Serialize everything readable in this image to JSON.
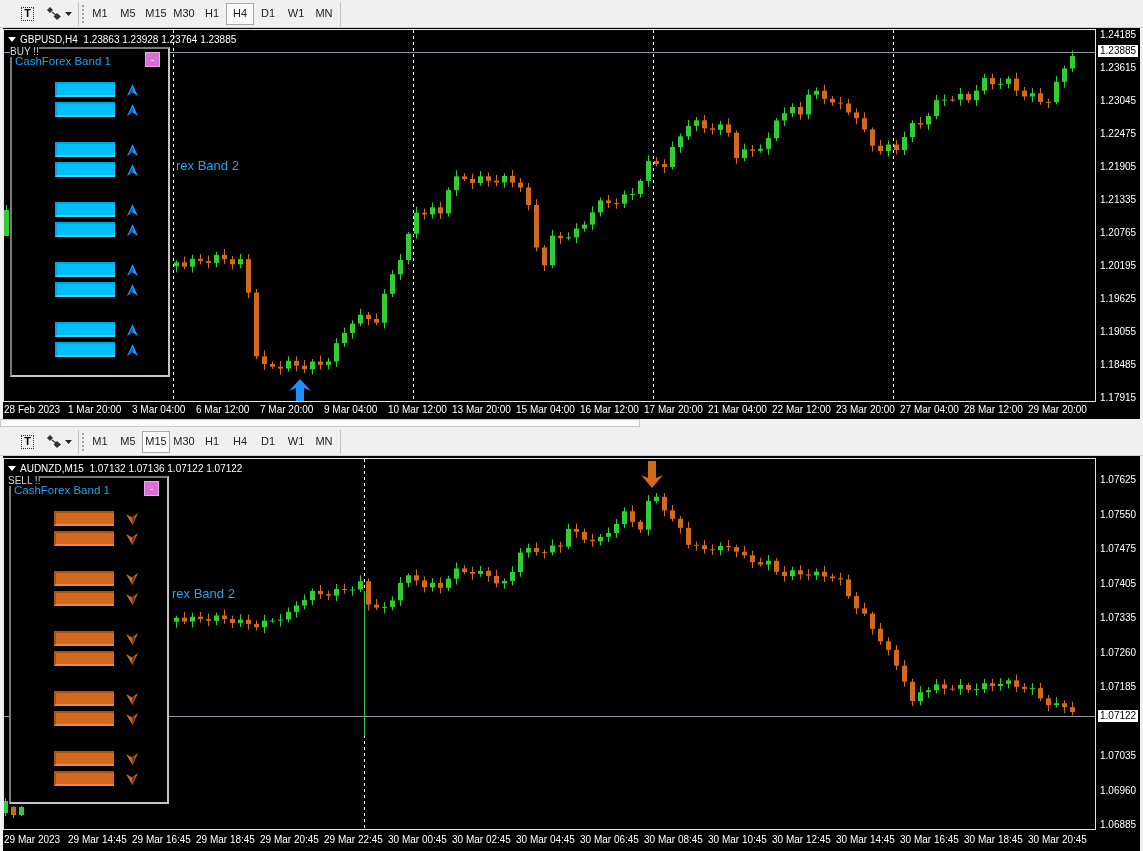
{
  "windows": [
    {
      "toolbar": {
        "text_tool": "T",
        "timeframes": [
          {
            "label": "M1",
            "selected": false
          },
          {
            "label": "M5",
            "selected": false
          },
          {
            "label": "M15",
            "selected": false
          },
          {
            "label": "M30",
            "selected": false
          },
          {
            "label": "H1",
            "selected": false
          },
          {
            "label": "H4",
            "selected": true
          },
          {
            "label": "D1",
            "selected": false
          },
          {
            "label": "W1",
            "selected": false
          },
          {
            "label": "MN",
            "selected": false
          }
        ]
      },
      "chart": {
        "header": "GBPUSD,H4  1.23863 1.23928 1.23764 1.23885",
        "signal": {
          "kind": "buy",
          "label": "BUY !!"
        },
        "panel": {
          "title": "CashForex Band 1",
          "minimize": "-"
        },
        "overlay_label": "rex Band 2",
        "price_axis": {
          "ticks": [
            "1.24185",
            "1.23615",
            "1.23045",
            "1.22475",
            "1.21905",
            "1.21335",
            "1.20765",
            "1.20195",
            "1.19625",
            "1.19055",
            "1.18485",
            "1.17915"
          ],
          "current": "1.23885"
        },
        "time_axis": [
          "28 Feb 2023",
          "1 Mar 20:00",
          "3 Mar 04:00",
          "6 Mar 12:00",
          "7 Mar 20:00",
          "9 Mar 04:00",
          "10 Mar 12:00",
          "13 Mar 20:00",
          "15 Mar 04:00",
          "16 Mar 12:00",
          "17 Mar 20:00",
          "21 Mar 04:00",
          "22 Mar 12:00",
          "23 Mar 20:00",
          "27 Mar 04:00",
          "28 Mar 12:00",
          "29 Mar 20:00"
        ]
      }
    },
    {
      "toolbar": {
        "text_tool": "T",
        "timeframes": [
          {
            "label": "M1",
            "selected": false
          },
          {
            "label": "M5",
            "selected": false
          },
          {
            "label": "M15",
            "selected": true
          },
          {
            "label": "M30",
            "selected": false
          },
          {
            "label": "H1",
            "selected": false
          },
          {
            "label": "H4",
            "selected": false
          },
          {
            "label": "D1",
            "selected": false
          },
          {
            "label": "W1",
            "selected": false
          },
          {
            "label": "MN",
            "selected": false
          }
        ]
      },
      "chart": {
        "header": "AUDNZD,M15  1.07132 1.07136 1.07122 1.07122",
        "signal": {
          "kind": "sell",
          "label": "SELL !!"
        },
        "panel": {
          "title": "CashForex Band 1",
          "minimize": "-"
        },
        "overlay_label": "rex Band 2",
        "price_axis": {
          "ticks": [
            "1.07625",
            "1.07550",
            "1.07475",
            "1.07405",
            "1.07335",
            "1.07260",
            "1.07185",
            "1.07035",
            "1.06960",
            "1.06885"
          ],
          "current": "1.07122"
        },
        "time_axis": [
          "29 Mar 2023",
          "29 Mar 14:45",
          "29 Mar 16:45",
          "29 Mar 18:45",
          "29 Mar 20:45",
          "29 Mar 22:45",
          "30 Mar 00:45",
          "30 Mar 02:45",
          "30 Mar 04:45",
          "30 Mar 06:45",
          "30 Mar 08:45",
          "30 Mar 10:45",
          "30 Mar 12:45",
          "30 Mar 14:45",
          "30 Mar 16:45",
          "30 Mar 18:45",
          "30 Mar 20:45"
        ]
      }
    }
  ]
}
